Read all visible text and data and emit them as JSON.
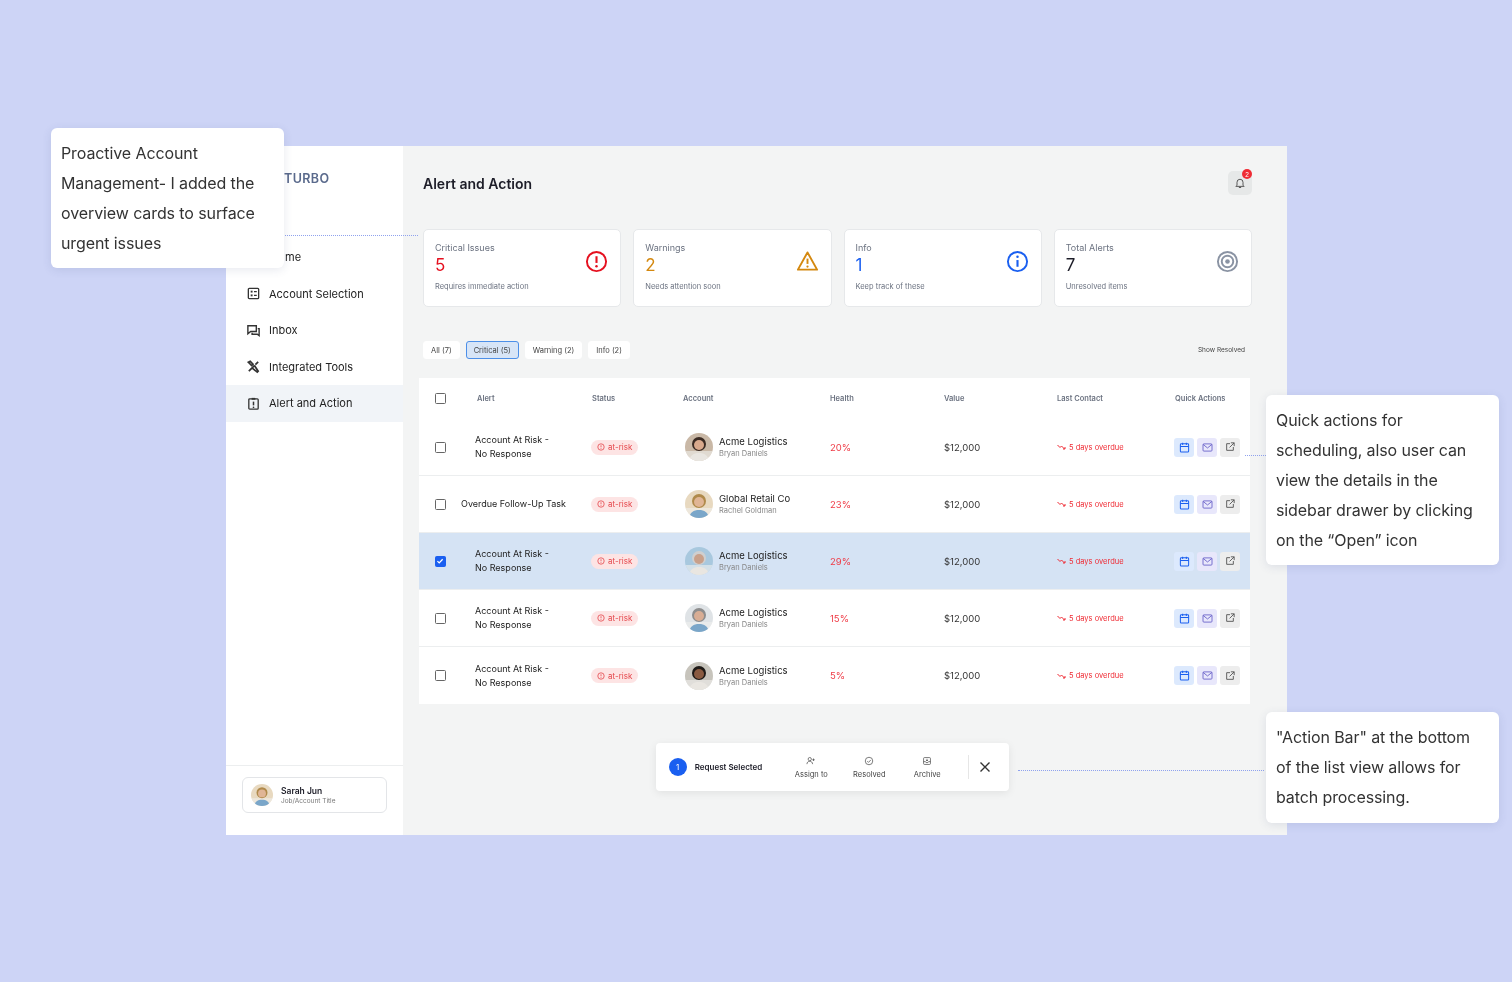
{
  "sidebar": {
    "logo": "TURBO",
    "items": [
      {
        "label": "me",
        "selected": false
      },
      {
        "label": "Account Selection",
        "selected": false
      },
      {
        "label": "Inbox",
        "selected": false
      },
      {
        "label": "Integrated Tools",
        "selected": false
      },
      {
        "label": "Alert and Action",
        "selected": true
      }
    ],
    "user": {
      "name": "Sarah Jun",
      "title": "Job/Account Title"
    }
  },
  "header": {
    "title": "Alert and Action",
    "notification_count": "2"
  },
  "cards": [
    {
      "kind": "critical",
      "label": "Critical Issues",
      "value": "5",
      "note": "Requires immediate action"
    },
    {
      "kind": "warning",
      "label": "Warnings",
      "value": "2",
      "note": "Needs attention soon"
    },
    {
      "kind": "info",
      "label": "Info",
      "value": "1",
      "note": "Keep track of these"
    },
    {
      "kind": "total",
      "label": "Total Alerts",
      "value": "7",
      "note": "Unresolved items"
    }
  ],
  "filters": [
    {
      "label": "All (7)",
      "selected": false
    },
    {
      "label": "Critical (5)",
      "selected": true
    },
    {
      "label": "Warning (2)",
      "selected": false
    },
    {
      "label": "Info (2)",
      "selected": false
    }
  ],
  "show_resolved": "Show Resolved",
  "table": {
    "select_all_checked": false,
    "columns": [
      "Alert",
      "Status",
      "Account",
      "Health",
      "Value",
      "Last Contact",
      "Quick Actions"
    ],
    "rows": [
      {
        "selected": false,
        "alert": "Account At Risk - No Response",
        "status": "at-risk",
        "account": "Acme Logistics",
        "contact": "Bryan Daniels",
        "health": "20%",
        "value": "$12,000",
        "last_contact": "5 days overdue"
      },
      {
        "selected": false,
        "alert": "Overdue Follow-Up Task",
        "status": "at-risk",
        "account": "Global Retail Co",
        "contact": "Rachel Goldman",
        "health": "23%",
        "value": "$12,000",
        "last_contact": "5 days overdue"
      },
      {
        "selected": true,
        "alert": "Account At Risk - No Response",
        "status": "at-risk",
        "account": "Acme Logistics",
        "contact": "Bryan Daniels",
        "health": "29%",
        "value": "$12,000",
        "last_contact": "5 days overdue"
      },
      {
        "selected": false,
        "alert": "Account At Risk - No Response",
        "status": "at-risk",
        "account": "Acme Logistics",
        "contact": "Bryan Daniels",
        "health": "15%",
        "value": "$12,000",
        "last_contact": "5 days overdue"
      },
      {
        "selected": false,
        "alert": "Account At Risk - No Response",
        "status": "at-risk",
        "account": "Acme Logistics",
        "contact": "Bryan Daniels",
        "health": "5%",
        "value": "$12,000",
        "last_contact": "5 days overdue"
      }
    ]
  },
  "action_bar": {
    "count": "1",
    "label": "Request Selected",
    "actions": [
      {
        "kind": "assign",
        "label": "Assign to"
      },
      {
        "kind": "resolve",
        "label": "Resolved"
      },
      {
        "kind": "archive",
        "label": "Archive"
      }
    ]
  },
  "annotations": [
    {
      "text": "Proactive Account Management- I added the overview cards to surface urgent issues"
    },
    {
      "text": "Quick actions for scheduling, also user can view the details in the sidebar drawer by clicking on the “Open” icon"
    },
    {
      "text": "\"Action Bar\" at the bottom of the list view allows for batch processing."
    }
  ]
}
